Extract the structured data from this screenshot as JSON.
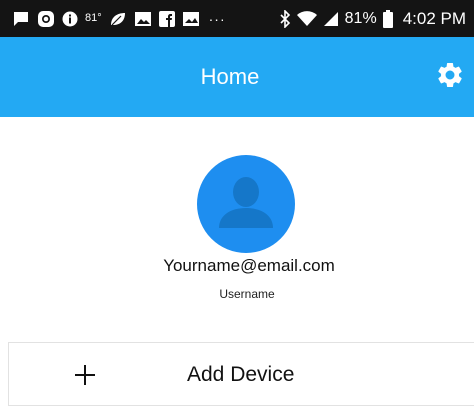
{
  "status_bar": {
    "left_icons": [
      "chat-icon",
      "instagram-icon",
      "info-icon"
    ],
    "temperature": "81°",
    "more_icons": [
      "leaf-icon",
      "image-icon",
      "facebook-icon",
      "photo-icon"
    ],
    "dots": "···",
    "right_icons": [
      "bluetooth-icon",
      "wifi-icon",
      "signal-icon"
    ],
    "battery_percent": "81%",
    "time": "4:02 PM"
  },
  "app_bar": {
    "title": "Home",
    "settings_icon": "gear-icon",
    "color": "#23a9f3"
  },
  "profile": {
    "avatar_icon": "user-silhouette-icon",
    "avatar_color": "#1e8ef0",
    "email": "Yourname@email.com",
    "username": "Username"
  },
  "actions": {
    "add_device_label": "Add Device",
    "add_icon": "plus-icon"
  }
}
